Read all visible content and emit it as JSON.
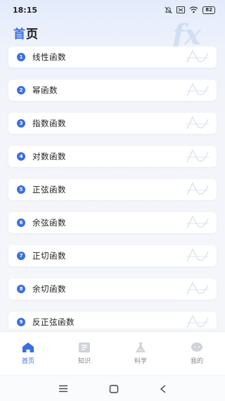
{
  "status": {
    "time": "18:15",
    "battery": "82"
  },
  "header": {
    "title_first": "首",
    "title_rest": "页",
    "watermark": "fx"
  },
  "functions": [
    {
      "num": "1",
      "label": "线性函数"
    },
    {
      "num": "2",
      "label": "幂函数"
    },
    {
      "num": "3",
      "label": "指数函数"
    },
    {
      "num": "4",
      "label": "对数函数"
    },
    {
      "num": "5",
      "label": "正弦函数"
    },
    {
      "num": "6",
      "label": "余弦函数"
    },
    {
      "num": "7",
      "label": "正切函数"
    },
    {
      "num": "8",
      "label": "余切函数"
    },
    {
      "num": "9",
      "label": "反正弦函数"
    }
  ],
  "tabs": [
    {
      "label": "首页",
      "icon": "home-icon",
      "active": true
    },
    {
      "label": "知识",
      "icon": "book-icon",
      "active": false
    },
    {
      "label": "科学",
      "icon": "flask-icon",
      "active": false
    },
    {
      "label": "我的",
      "icon": "chat-icon",
      "active": false
    }
  ],
  "colors": {
    "accent": "#3b6fe0",
    "inactive": "#888888"
  }
}
